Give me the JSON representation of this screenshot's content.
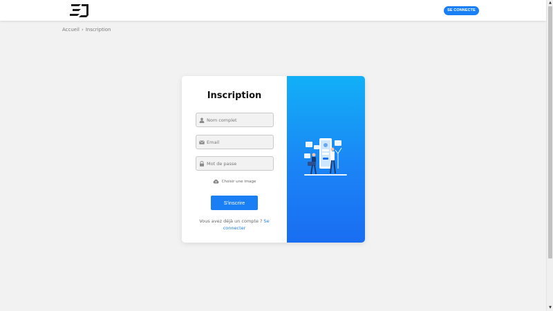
{
  "header": {
    "connect_label": "SE CONNECTE"
  },
  "breadcrumb": {
    "home": "Accueil",
    "separator": "›",
    "current": "Inscription"
  },
  "form": {
    "title": "Inscription",
    "name_placeholder": "Nom complet",
    "email_placeholder": "Email",
    "password_placeholder": "Mot de passe",
    "image_label": "Choisir une image",
    "submit_label": "S'inscrire",
    "login_prompt": "Vous avez déjà un compte ?",
    "login_link": "Se connecter"
  },
  "colors": {
    "accent": "#1a7ff5",
    "panel_gradient_top": "#12b0f7",
    "panel_gradient_bottom": "#1a6df2",
    "background": "#f2f2f2"
  },
  "icons": {
    "logo": "brand-logo",
    "name": "user-icon",
    "email": "envelope-icon",
    "password": "lock-icon",
    "image": "cloud-upload-icon"
  }
}
